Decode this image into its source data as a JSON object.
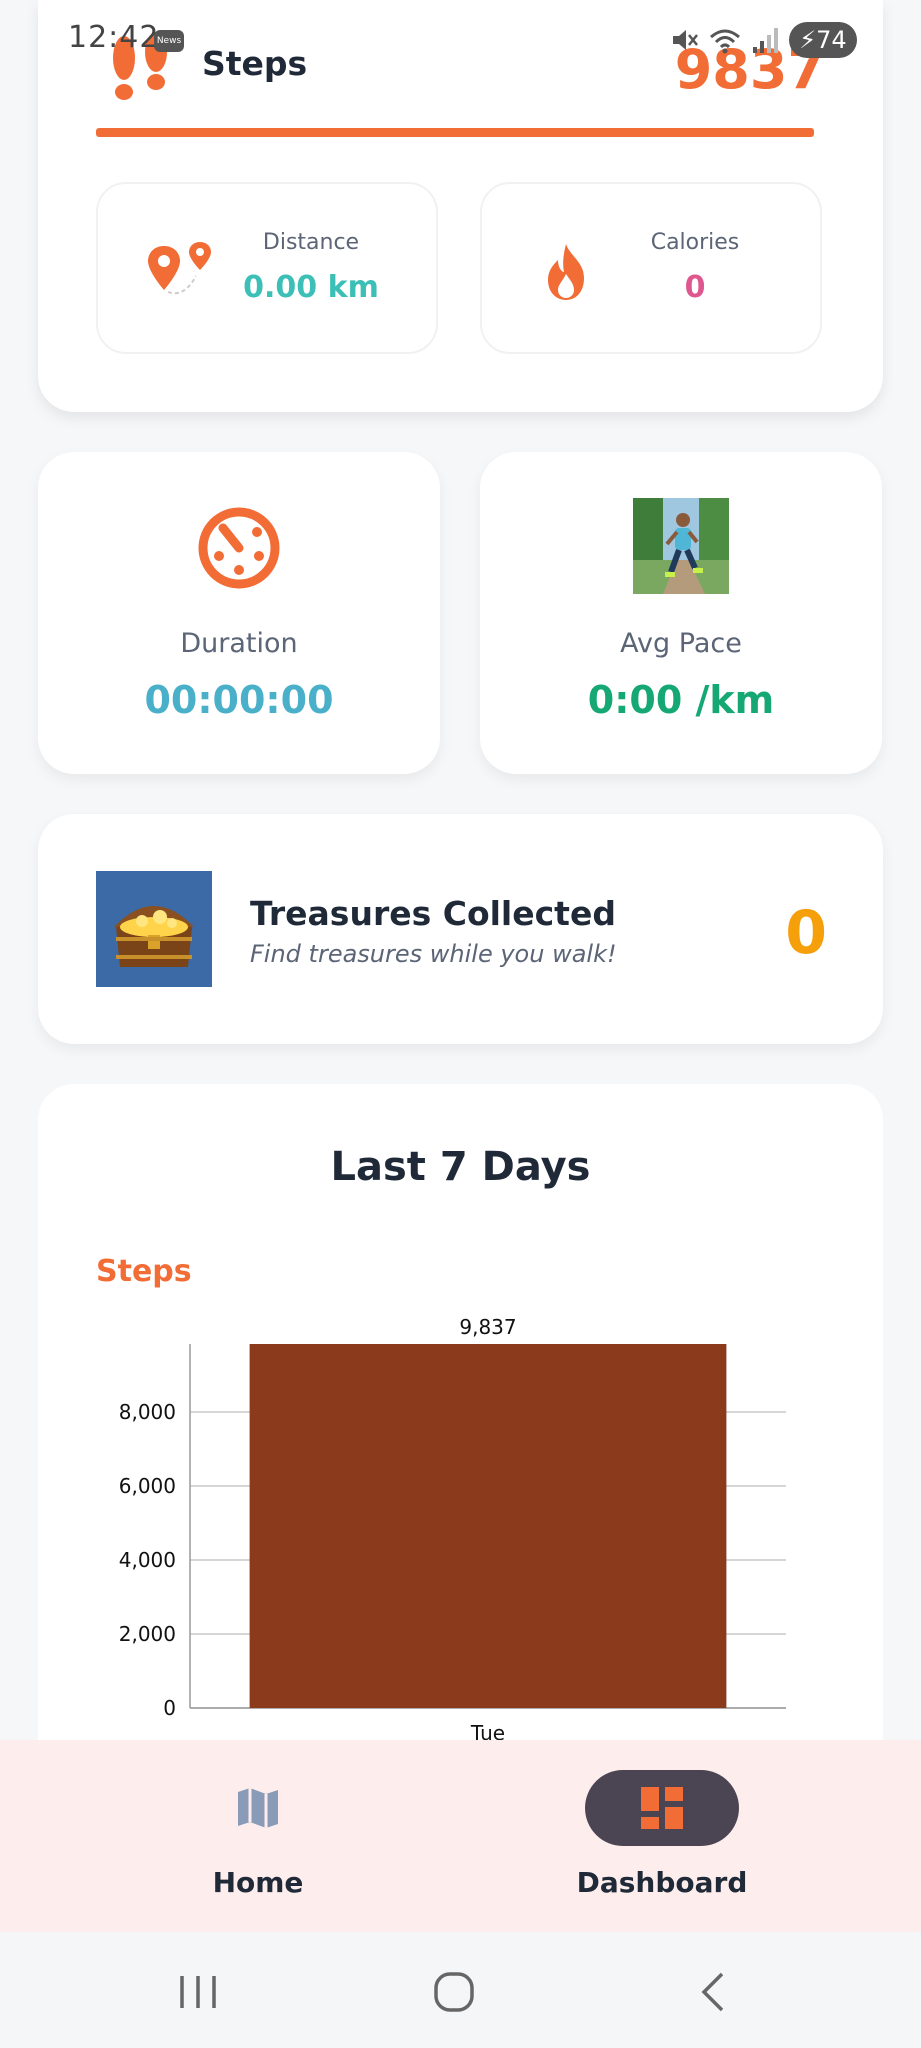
{
  "status_bar": {
    "time": "12:42",
    "news_badge": "News",
    "battery": "74",
    "icons": [
      "mute-icon",
      "wifi-icon",
      "signal-icon",
      "battery-icon"
    ]
  },
  "steps_header": {
    "title": "Steps",
    "count": "9837",
    "icon": "footprints-icon",
    "accent_color": "#f26c35"
  },
  "mini_stats": [
    {
      "label": "Distance",
      "value": "0.00 km",
      "icon": "map-pin-icon",
      "value_color": "#3bbfb6"
    },
    {
      "label": "Calories",
      "value": "0",
      "icon": "flame-icon",
      "value_color": "#e0568f"
    }
  ],
  "stat_cards": [
    {
      "label": "Duration",
      "value": "00:00:00",
      "icon": "stopwatch-icon",
      "value_color": "#4ab0c9"
    },
    {
      "label": "Avg Pace",
      "value": "0:00 /km",
      "icon": "runner-image",
      "value_color": "#16a874"
    }
  ],
  "treasure": {
    "title": "Treasures Collected",
    "subtitle": "Find treasures while you walk!",
    "count": "0",
    "icon": "treasure-chest-image"
  },
  "chart_section": {
    "title": "Last 7 Days",
    "series_label": "Steps"
  },
  "chart_data": {
    "type": "bar",
    "categories": [
      "Tue"
    ],
    "series": [
      {
        "values": [
          9837
        ]
      }
    ],
    "data_labels": [
      "9,837"
    ],
    "y_ticks": [
      "0",
      "2,000",
      "4,000",
      "6,000",
      "8,000"
    ],
    "y_tick_values": [
      0,
      2000,
      4000,
      6000,
      8000
    ],
    "ylim": [
      0,
      9837
    ],
    "bar_color": "#8b3a1c",
    "grid": true
  },
  "bottom_nav": {
    "items": [
      {
        "label": "Home",
        "icon": "map-icon",
        "active": false
      },
      {
        "label": "Dashboard",
        "icon": "dashboard-icon",
        "active": true
      }
    ]
  },
  "system_nav": [
    "recents-icon",
    "home-circle-icon",
    "back-icon"
  ]
}
